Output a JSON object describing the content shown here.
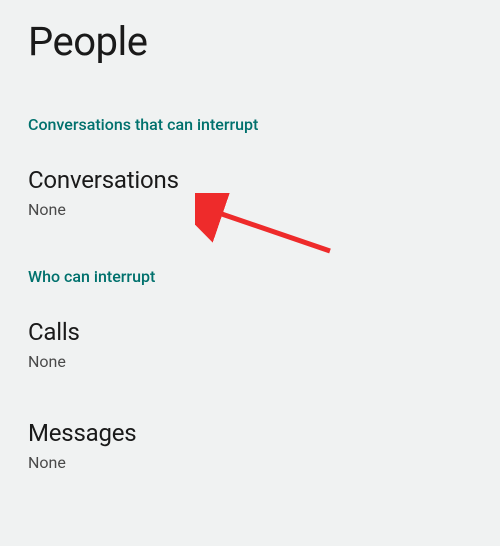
{
  "page": {
    "title": "People"
  },
  "sections": {
    "conversations_section": {
      "label": "Conversations that can interrupt",
      "items": {
        "conversations": {
          "title": "Conversations",
          "value": "None"
        }
      }
    },
    "interrupt_section": {
      "label": "Who can interrupt",
      "items": {
        "calls": {
          "title": "Calls",
          "value": "None"
        },
        "messages": {
          "title": "Messages",
          "value": "None"
        }
      }
    }
  }
}
